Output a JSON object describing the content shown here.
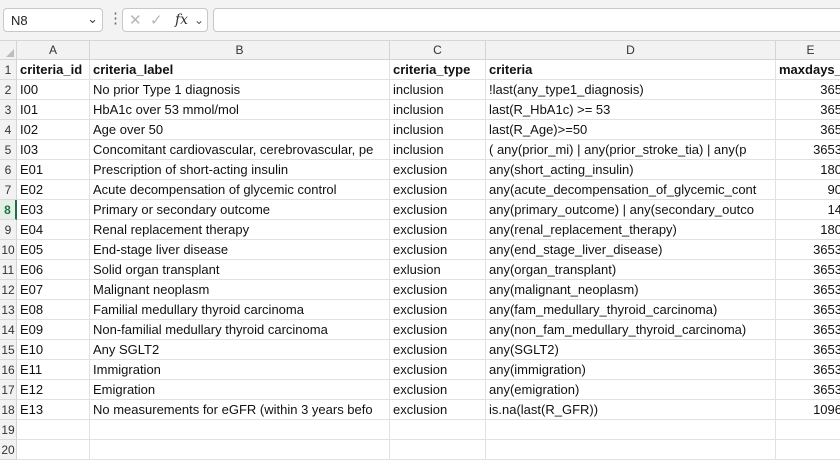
{
  "formula_bar": {
    "name_box": "N8",
    "formula": ""
  },
  "columns": [
    "A",
    "B",
    "C",
    "D",
    "E"
  ],
  "rows": [
    [
      "criteria_id",
      "criteria_label",
      "criteria_type",
      "criteria",
      "maxdays_"
    ],
    [
      "I00",
      "No prior Type 1 diagnosis",
      "inclusion",
      "!last(any_type1_diagnosis)",
      "365"
    ],
    [
      "I01",
      "HbA1c over 53 mmol/mol",
      "inclusion",
      "last(R_HbA1c) >= 53",
      "365"
    ],
    [
      "I02",
      "Age over 50",
      "inclusion",
      "last(R_Age)>=50",
      "365"
    ],
    [
      "I03",
      "Concomitant cardiovascular, cerebrovascular, pe",
      "inclusion",
      "( any(prior_mi) | any(prior_stroke_tia) | any(p",
      "3653"
    ],
    [
      "E01",
      "Prescription of short-acting insulin",
      "exclusion",
      "any(short_acting_insulin)",
      "180"
    ],
    [
      "E02",
      "Acute decompensation of glycemic control",
      "exclusion",
      "any(acute_decompensation_of_glycemic_cont",
      "90"
    ],
    [
      "E03",
      "Primary or secondary outcome",
      "exclusion",
      "any(primary_outcome) | any(secondary_outco",
      "14"
    ],
    [
      "E04",
      "Renal replacement therapy",
      "exclusion",
      "any(renal_replacement_therapy)",
      "180"
    ],
    [
      "E05",
      "End-stage liver disease",
      "exclusion",
      "any(end_stage_liver_disease)",
      "3653"
    ],
    [
      "E06",
      "Solid organ transplant",
      "exlusion",
      "any(organ_transplant)",
      "3653"
    ],
    [
      "E07",
      "Malignant neoplasm",
      "exclusion",
      "any(malignant_neoplasm)",
      "3653"
    ],
    [
      "E08",
      "Familial medullary thyroid carcinoma",
      "exclusion",
      "any(fam_medullary_thyroid_carcinoma)",
      "3653"
    ],
    [
      "E09",
      "Non-familial medullary thyroid carcinoma",
      "exclusion",
      "any(non_fam_medullary_thyroid_carcinoma)",
      "3653"
    ],
    [
      "E10",
      "Any SGLT2",
      "exclusion",
      "any(SGLT2)",
      "3653"
    ],
    [
      "E11",
      "Immigration",
      "exclusion",
      "any(immigration)",
      "3653"
    ],
    [
      "E12",
      "Emigration",
      "exclusion",
      "any(emigration)",
      "3653"
    ],
    [
      "E13",
      "No measurements for eGFR (within 3 years befo",
      "exclusion",
      "is.na(last(R_GFR))",
      "1096"
    ],
    [
      "",
      "",
      "",
      "",
      ""
    ],
    [
      "",
      "",
      "",
      "",
      ""
    ]
  ],
  "selected_row": 8
}
